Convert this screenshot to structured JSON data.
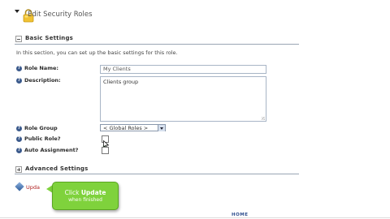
{
  "header": {
    "title": "Edit Security Roles"
  },
  "basic_settings": {
    "heading": "Basic Settings",
    "description": "In this section, you can set up the basic settings for this role.",
    "role_name_label": "Role Name:",
    "role_name_value": "My Clients",
    "description_label": "Description:",
    "description_value": "Clients group",
    "role_group_label": "Role Group",
    "role_group_value": "< Global Roles >",
    "public_role_label": "Public Role?",
    "public_role_checked": true,
    "auto_assignment_label": "Auto Assignment?",
    "auto_assignment_checked": false
  },
  "advanced_settings": {
    "heading": "Advanced Settings"
  },
  "actions": {
    "update_label": "Upda"
  },
  "tooltip": {
    "prefix": "Click",
    "action": "Update",
    "suffix": "when finished"
  },
  "footer": {
    "home_label": "HOME"
  },
  "colors": {
    "tooltip_green": "#7fd23c",
    "link_red": "#b02020",
    "rule_blue": "#9aa6b4"
  },
  "icons": {
    "header": "lock-icon",
    "help": "help-icon",
    "update": "diamond-icon"
  }
}
